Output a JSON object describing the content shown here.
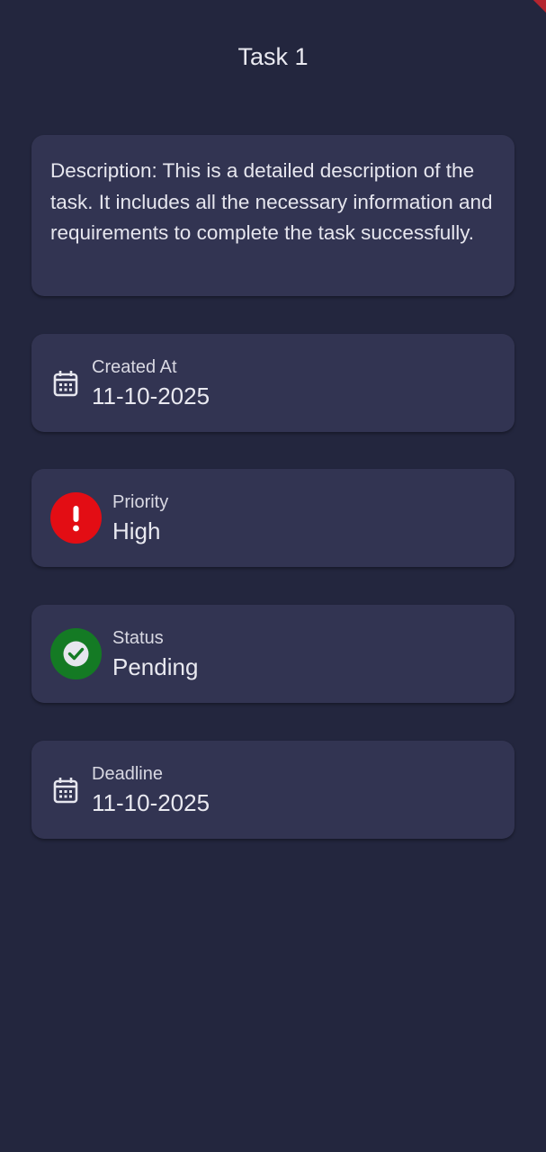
{
  "task": {
    "title": "Task 1",
    "description": "Description: This is a detailed description of the task. It includes all the necessary information and requirements to complete the task successfully."
  },
  "details": {
    "created": {
      "label": "Created At",
      "value": "11-10-2025",
      "icon": "calendar-icon"
    },
    "priority": {
      "label": "Priority",
      "value": "High",
      "icon": "exclamation-icon",
      "color": "#e30d14"
    },
    "status": {
      "label": "Status",
      "value": "Pending",
      "icon": "check-circle-icon",
      "color": "#147a24"
    },
    "deadline": {
      "label": "Deadline",
      "value": "11-10-2025",
      "icon": "calendar-icon"
    }
  },
  "colors": {
    "background": "#23263e",
    "card": "#323452",
    "corner_accent": "#b4252f"
  }
}
